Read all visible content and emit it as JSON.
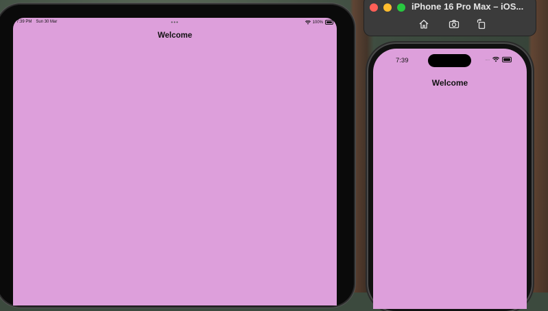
{
  "ipad": {
    "status_time": "7:39 PM",
    "status_date": "Sun 30 Mar",
    "status_dots": "•••",
    "battery_text": "100%",
    "nav_title": "Welcome",
    "background_color": "#dd9fdb"
  },
  "simulator_window": {
    "title": "iPhone 16 Pro Max – iOS...",
    "toolbar": {
      "home_icon": "home-icon",
      "screenshot_icon": "camera-icon",
      "rotate_icon": "rotate-icon"
    },
    "traffic_lights": {
      "close": "#ff5f57",
      "minimize": "#febc2e",
      "zoom": "#28c840"
    }
  },
  "iphone": {
    "status_time": "7:39",
    "signal_text": "....",
    "nav_title": "Welcome",
    "background_color": "#dd9fdb"
  }
}
